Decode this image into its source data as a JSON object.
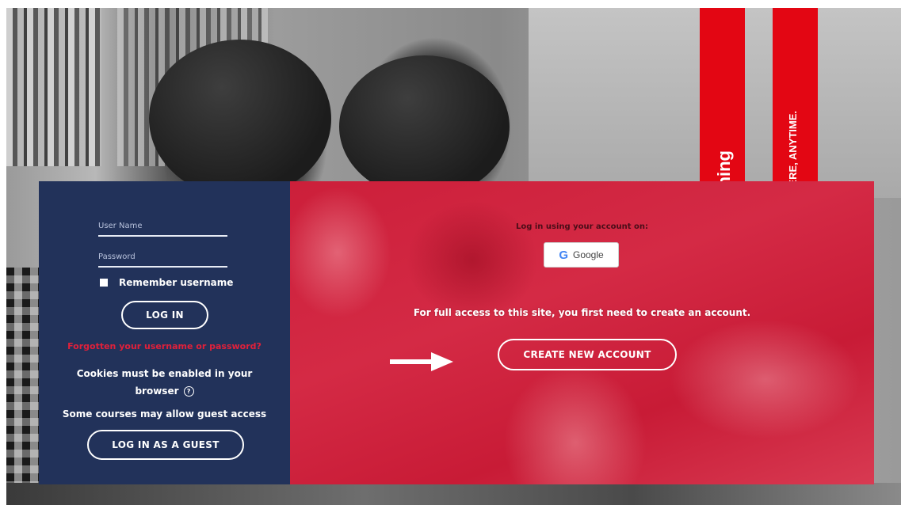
{
  "left_panel": {
    "username_placeholder": "User Name",
    "password_placeholder": "Password",
    "remember_label": "Remember username",
    "login_button": "LOG IN",
    "forgot_link": "Forgotten your username or password?",
    "cookies_line1": "Cookies must be enabled in your",
    "cookies_line2": "browser",
    "help_icon": "?",
    "guest_text": "Some courses may allow guest access",
    "guest_button": "LOG IN AS A GUEST"
  },
  "right_panel": {
    "login_using": "Log in using your account on:",
    "google_label": "Google",
    "google_icon": "G",
    "full_access": "For full access to this site, you first need to create an account.",
    "create_button": "CREATE NEW ACCOUNT"
  },
  "background": {
    "banner_1": "ning",
    "banner_2": "ERE, ANYTIME."
  },
  "colors": {
    "left_panel_bg": "#22325a",
    "right_panel_tint": "#cc1f3a",
    "forgot_link": "#e0203a",
    "banner_red": "#e30613"
  }
}
